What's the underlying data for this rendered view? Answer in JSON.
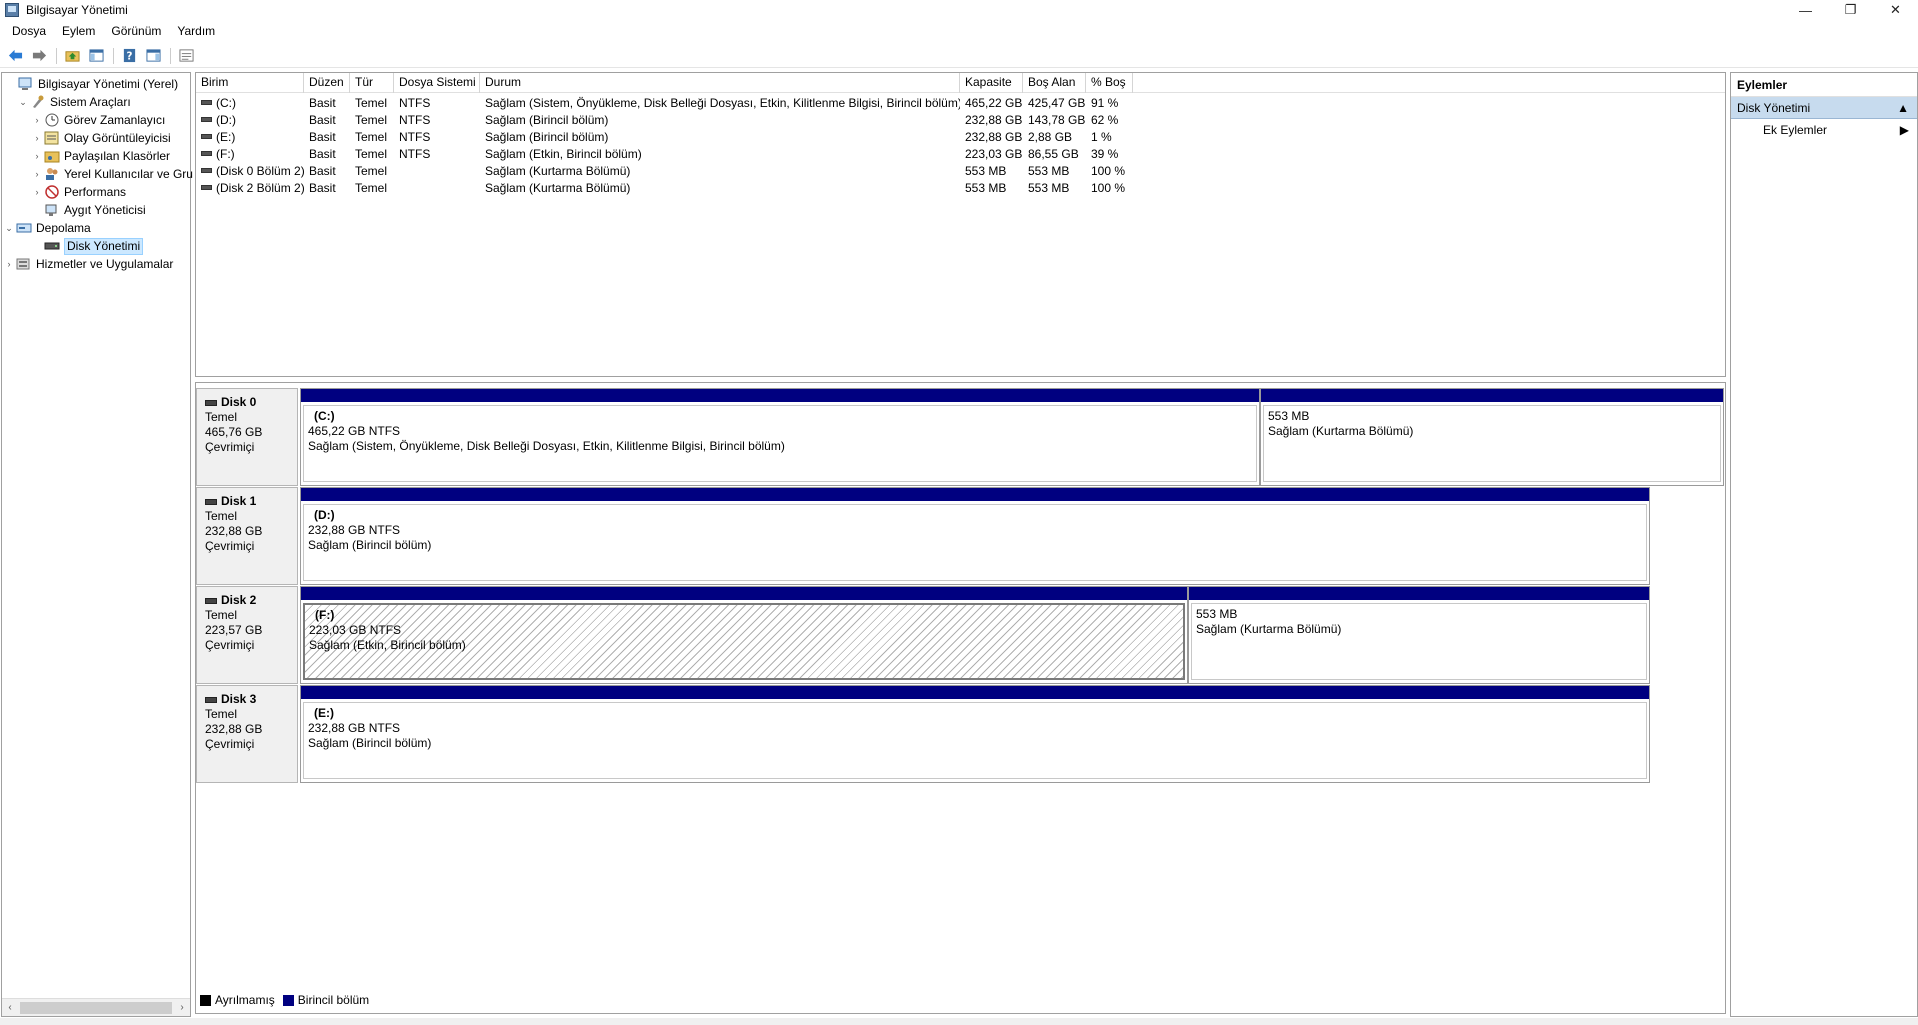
{
  "window": {
    "title": "Bilgisayar Yönetimi",
    "minimize": "—",
    "restore": "❐",
    "close": "✕"
  },
  "menu": {
    "file": "Dosya",
    "action": "Eylem",
    "view": "Görünüm",
    "help": "Yardım"
  },
  "tree": {
    "root": "Bilgisayar Yönetimi (Yerel)",
    "system_tools": "Sistem Araçları",
    "task_scheduler": "Görev Zamanlayıcı",
    "event_viewer": "Olay Görüntüleyicisi",
    "shared_folders": "Paylaşılan Klasörler",
    "local_users": "Yerel Kullanıcılar ve Gru",
    "performance": "Performans",
    "device_manager": "Aygıt Yöneticisi",
    "storage": "Depolama",
    "disk_management": "Disk Yönetimi",
    "services_apps": "Hizmetler ve Uygulamalar"
  },
  "volume_list": {
    "columns": {
      "volume": "Birim",
      "layout": "Düzen",
      "type": "Tür",
      "filesystem": "Dosya Sistemi",
      "status": "Durum",
      "capacity": "Kapasite",
      "free": "Boş Alan",
      "percent_free": "% Boş"
    },
    "rows": [
      {
        "volume": "(C:)",
        "layout": "Basit",
        "type": "Temel",
        "fs": "NTFS",
        "status": "Sağlam (Sistem, Önyükleme, Disk Belleği Dosyası, Etkin, Kilitlenme Bilgisi, Birincil bölüm)",
        "capacity": "465,22 GB",
        "free": "425,47 GB",
        "pct": "91 %"
      },
      {
        "volume": "(D:)",
        "layout": "Basit",
        "type": "Temel",
        "fs": "NTFS",
        "status": "Sağlam (Birincil bölüm)",
        "capacity": "232,88 GB",
        "free": "143,78 GB",
        "pct": "62 %"
      },
      {
        "volume": "(E:)",
        "layout": "Basit",
        "type": "Temel",
        "fs": "NTFS",
        "status": "Sağlam (Birincil bölüm)",
        "capacity": "232,88 GB",
        "free": "2,88 GB",
        "pct": "1 %"
      },
      {
        "volume": "(F:)",
        "layout": "Basit",
        "type": "Temel",
        "fs": "NTFS",
        "status": "Sağlam (Etkin, Birincil bölüm)",
        "capacity": "223,03 GB",
        "free": "86,55 GB",
        "pct": "39 %"
      },
      {
        "volume": "(Disk 0 Bölüm 2)",
        "layout": "Basit",
        "type": "Temel",
        "fs": "",
        "status": "Sağlam (Kurtarma Bölümü)",
        "capacity": "553 MB",
        "free": "553 MB",
        "pct": "100 %"
      },
      {
        "volume": "(Disk 2 Bölüm 2)",
        "layout": "Basit",
        "type": "Temel",
        "fs": "",
        "status": "Sağlam (Kurtarma Bölümü)",
        "capacity": "553 MB",
        "free": "553 MB",
        "pct": "100 %"
      }
    ]
  },
  "disks": [
    {
      "name": "Disk 0",
      "kind": "Temel",
      "size": "465,76 GB",
      "state": "Çevrimiçi",
      "partitions": [
        {
          "title": "(C:)",
          "size": "465,22 GB NTFS",
          "status": "Sağlam (Sistem, Önyükleme, Disk Belleği Dosyası, Etkin, Kilitlenme Bilgisi, Birincil bölüm)"
        },
        {
          "title": "",
          "size": "553 MB",
          "status": "Sağlam (Kurtarma Bölümü)"
        }
      ]
    },
    {
      "name": "Disk 1",
      "kind": "Temel",
      "size": "232,88 GB",
      "state": "Çevrimiçi",
      "partitions": [
        {
          "title": "(D:)",
          "size": "232,88 GB NTFS",
          "status": "Sağlam (Birincil bölüm)"
        }
      ]
    },
    {
      "name": "Disk 2",
      "kind": "Temel",
      "size": "223,57 GB",
      "state": "Çevrimiçi",
      "partitions": [
        {
          "title": "(F:)",
          "size": "223,03 GB NTFS",
          "status": "Sağlam (Etkin, Birincil bölüm)"
        },
        {
          "title": "",
          "size": "553 MB",
          "status": "Sağlam (Kurtarma Bölümü)"
        }
      ]
    },
    {
      "name": "Disk 3",
      "kind": "Temel",
      "size": "232,88 GB",
      "state": "Çevrimiçi",
      "partitions": [
        {
          "title": "(E:)",
          "size": "232,88 GB NTFS",
          "status": "Sağlam (Birincil bölüm)"
        }
      ]
    }
  ],
  "legend": {
    "unallocated": "Ayrılmamış",
    "primary": "Birincil bölüm",
    "unallocated_color": "#000000",
    "primary_color": "#000080"
  },
  "actions": {
    "header": "Eylemler",
    "section": "Disk Yönetimi",
    "more": "Ek Eylemler"
  }
}
